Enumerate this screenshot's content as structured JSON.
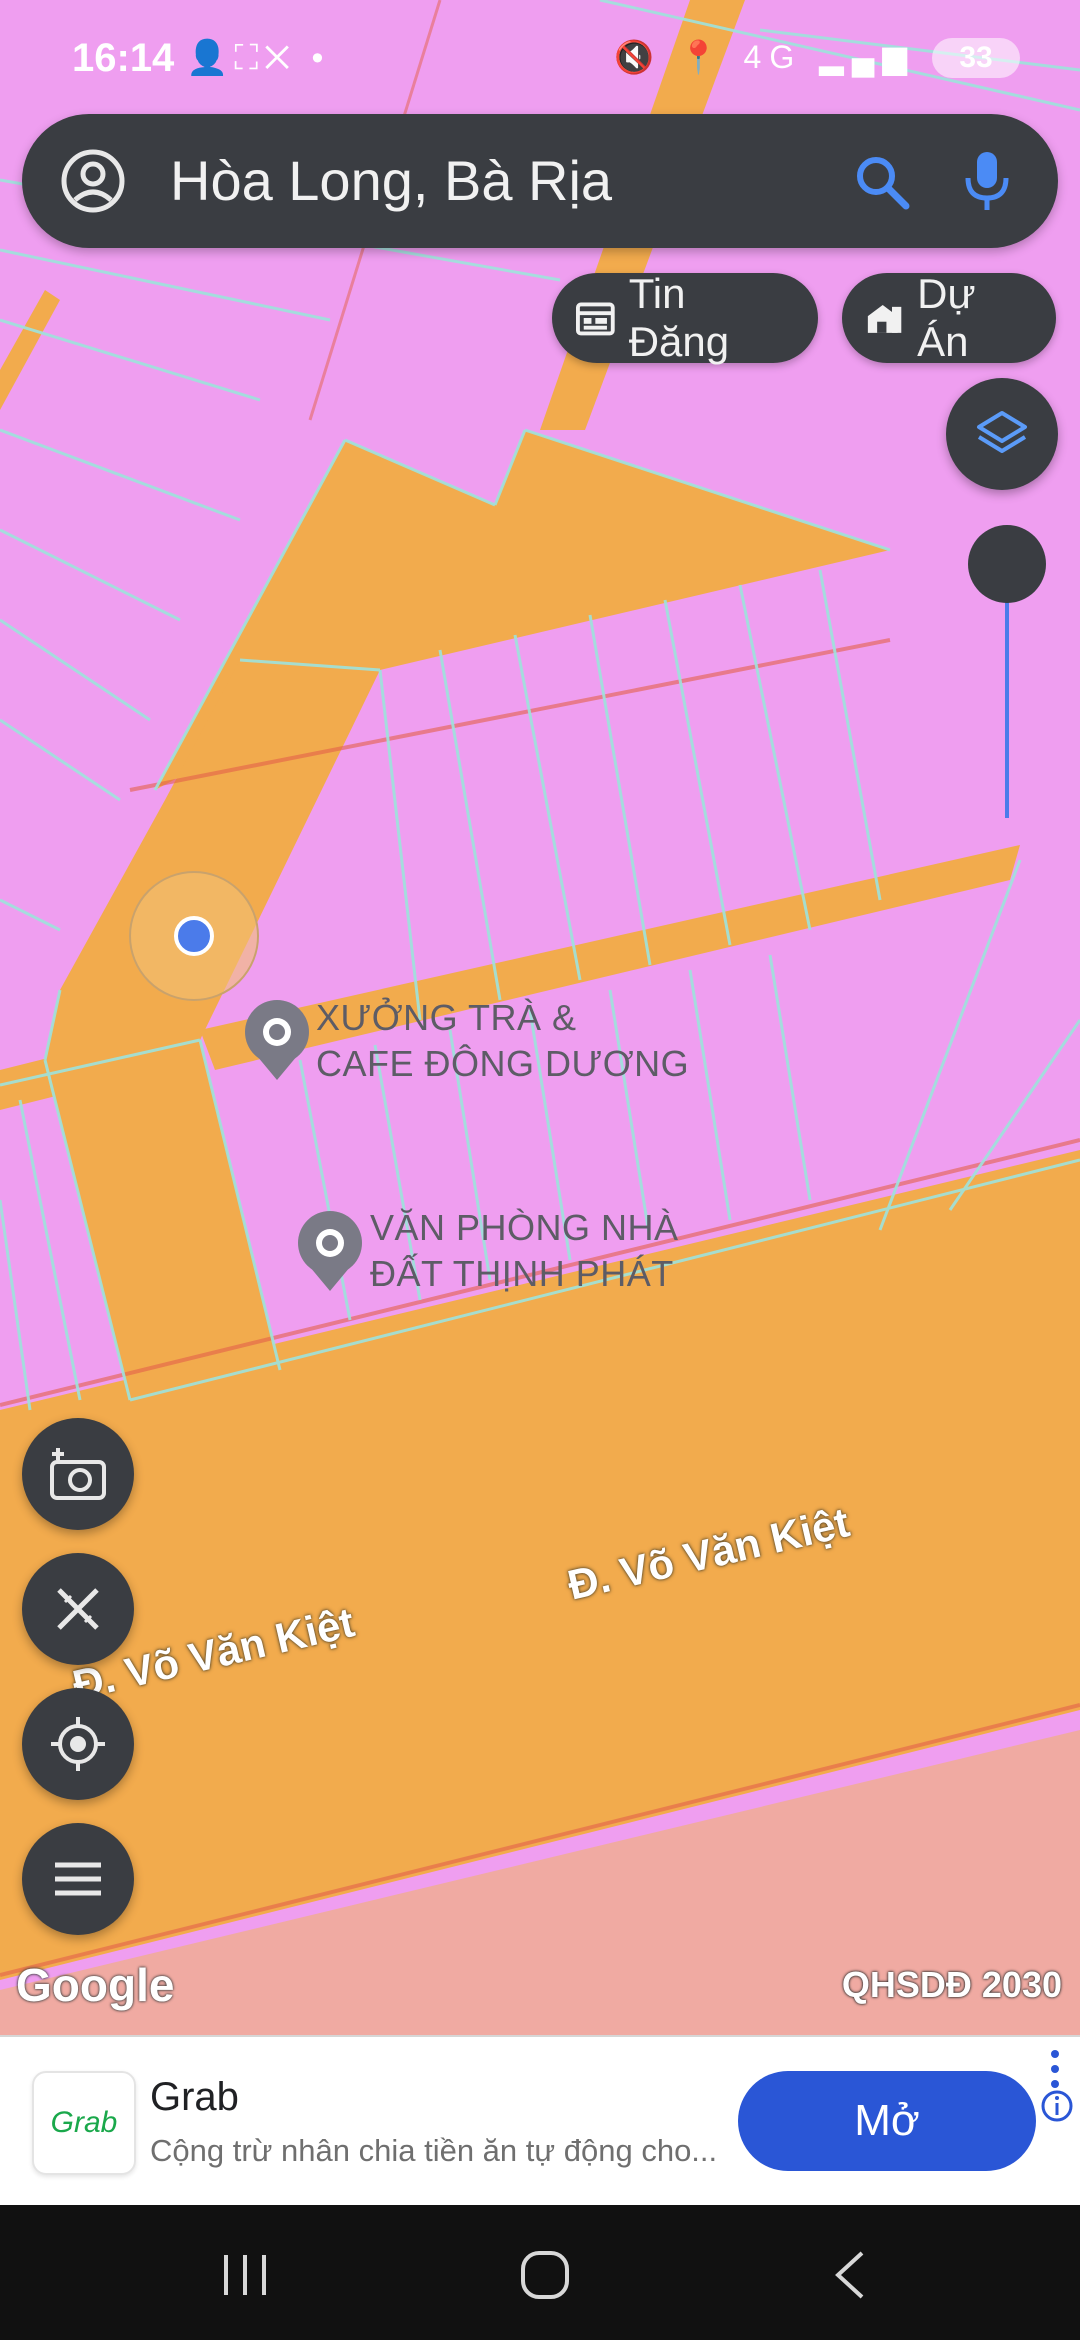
{
  "status_bar": {
    "time": "16:14",
    "notification_icons": "👤⛶✕ •",
    "system_icons": "🔇 📍 4G ▂▄▆",
    "battery": "33"
  },
  "search": {
    "query": "Hòa Long, Bà Rịa"
  },
  "chips": {
    "news": "Tin Đăng",
    "projects": "Dự Án"
  },
  "map": {
    "pois": [
      {
        "line1": "XƯỞNG TRÀ &",
        "line2": "CAFE ĐÔNG DƯƠNG"
      },
      {
        "line1": "VĂN PHÒNG NHÀ",
        "line2": "ĐẤT THỊNH PHÁT"
      }
    ],
    "roads": [
      "Đ. Võ Văn Kiệt",
      "Đ. Võ Văn Kiệt"
    ],
    "attribution": "Google",
    "plan_label": "QHSDĐ 2030",
    "colors": {
      "residential": "#ef9ef0",
      "road": "#f2ab4d",
      "lower_zone": "#f0aaa2",
      "parcel_line": "#9ee3dc",
      "location_dot": "#4b7bea"
    }
  },
  "icons": {
    "account": "account-circle-icon",
    "search": "search-icon",
    "mic": "mic-icon",
    "layers": "layers-icon",
    "camera": "add-photo-icon",
    "measure": "measure-icon",
    "locate": "my-location-icon",
    "menu": "menu-icon"
  },
  "ad": {
    "logo_text": "Grab",
    "title": "Grab",
    "description": "Cộng trừ nhân chia tiền ăn tự động cho...",
    "cta": "Mở"
  }
}
